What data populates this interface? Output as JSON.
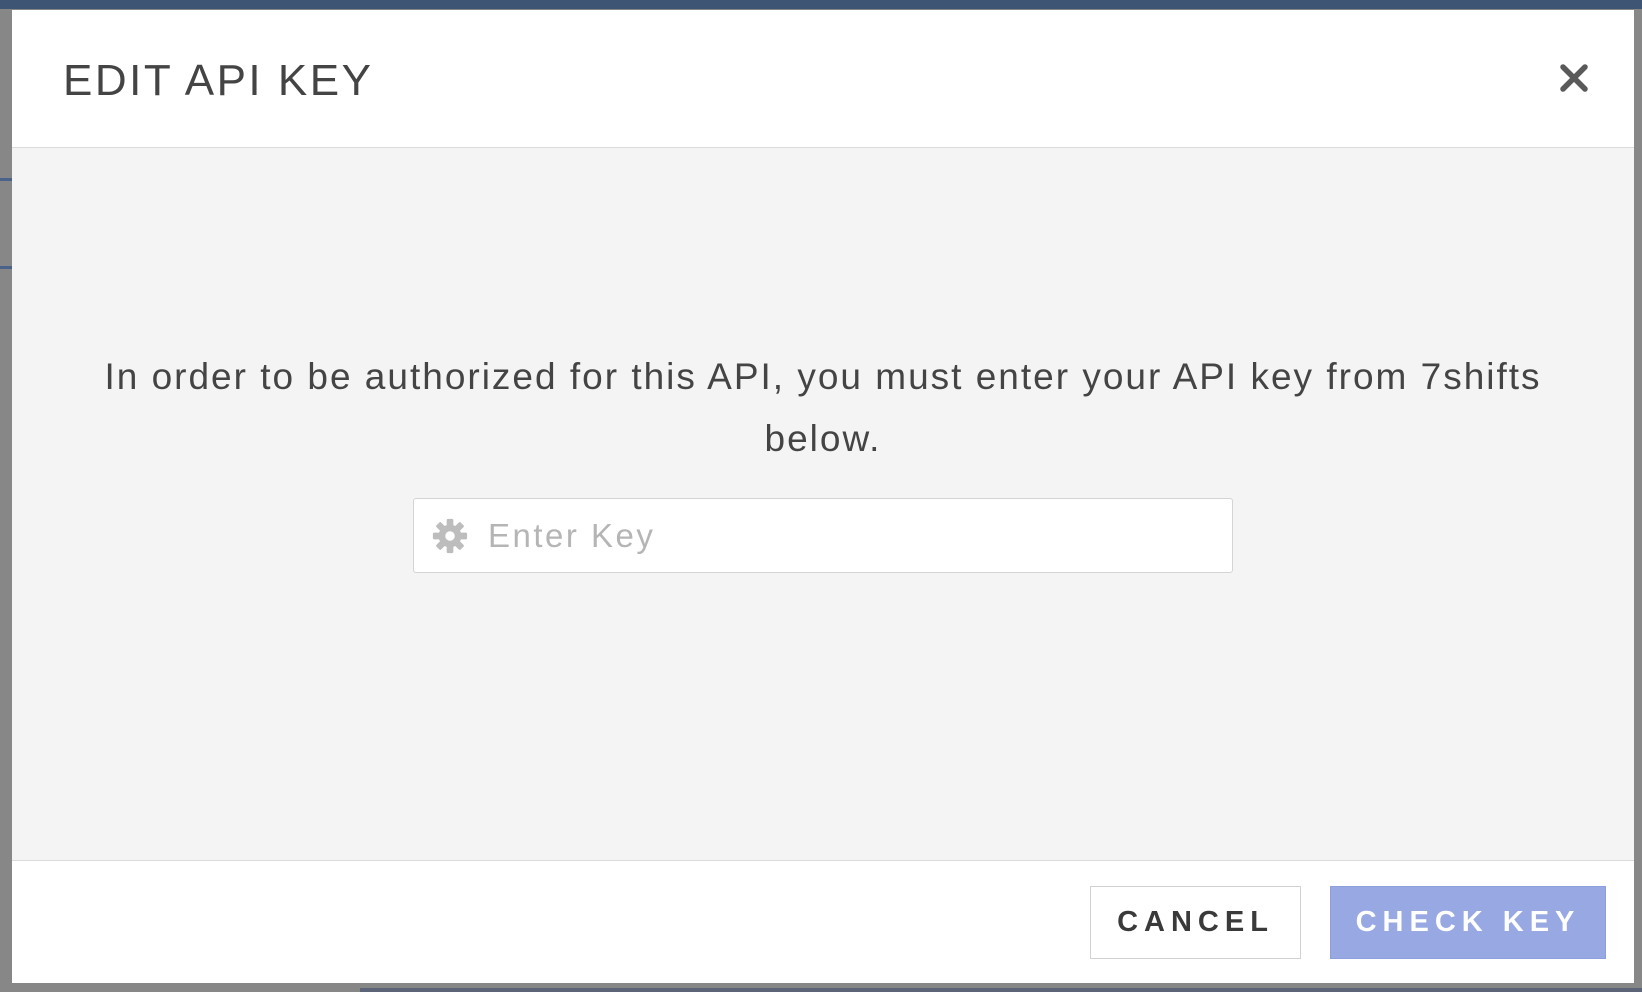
{
  "modal": {
    "title": "EDIT API KEY",
    "close_icon": "close-icon",
    "instruction": "In order to be authorized for this API, you must enter your API key from 7shifts below.",
    "key_field": {
      "icon": "gear-icon",
      "value": "",
      "placeholder": "Enter Key"
    },
    "footer": {
      "cancel_label": "CANCEL",
      "check_label": "CHECK KEY"
    }
  },
  "colors": {
    "primary_button": "#98a8e2",
    "backdrop": "#878787",
    "body_background": "#f4f4f4",
    "text": "#444444"
  }
}
